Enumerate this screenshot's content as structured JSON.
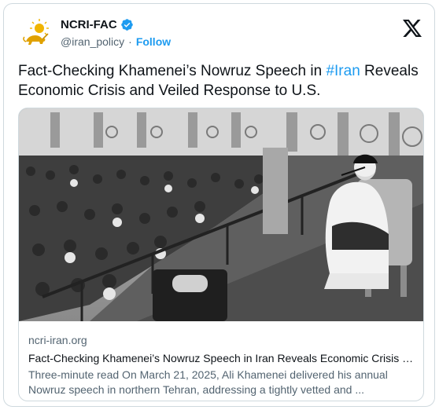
{
  "author": {
    "display_name": "NCRI-FAC",
    "handle": "@iran_policy",
    "separator": "·",
    "follow_label": "Follow",
    "verified": true,
    "avatar_icon": "lion-and-sun-emblem-icon"
  },
  "platform_icon": "x-logo-icon",
  "tweet": {
    "text_before": "Fact-Checking Khamenei’s Nowruz Speech in ",
    "hashtag": "#Iran",
    "text_after": " Reveals Economic Crisis and Veiled Response to U.S."
  },
  "card": {
    "image_description_icon": "speech-photo",
    "domain": "ncri-iran.org",
    "title": "Fact-Checking Khamenei’s Nowruz Speech in Iran Reveals Economic Crisis and Veiled Response to U.S.",
    "description_line1": "Three-minute read On March 21, 2025, Ali Khamenei delivered his annual",
    "description_line2": "Nowruz speech in northern Tehran, addressing a tightly vetted and ..."
  },
  "colors": {
    "accent": "#1d9bf0",
    "text_primary": "#0f1419",
    "text_secondary": "#536471",
    "border": "#cfd9de",
    "avatar_gold": "#e0a100"
  }
}
